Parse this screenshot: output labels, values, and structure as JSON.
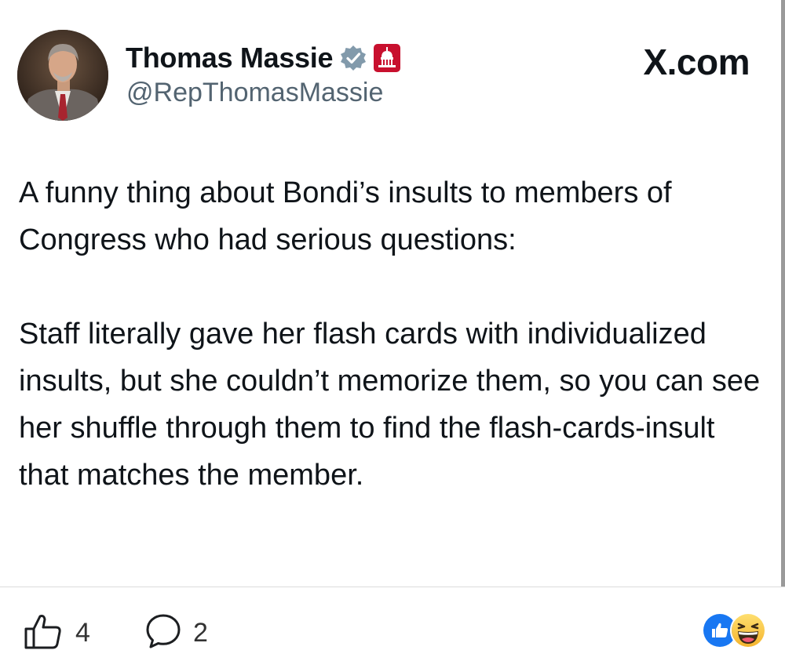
{
  "tweet": {
    "display_name": "Thomas Massie",
    "handle": "@RepThomasMassie",
    "site_label": "X.com",
    "paragraphs": [
      "A funny thing about Bondi’s insults to members of Congress who had serious questions:",
      "Staff literally gave her flash cards with individualized insults, but she couldn’t memorize them, so you can see her shuffle through them to find the flash-cards-insult that matches the member."
    ],
    "verified_badge_icon": "verified-badge-icon",
    "government_badge_icon": "us-capitol-icon"
  },
  "footer": {
    "like_count": "4",
    "comment_count": "2",
    "reactions": [
      "like-reaction-icon",
      "haha-reaction-icon"
    ]
  },
  "colors": {
    "text": "#0f1419",
    "handle": "#536471",
    "badge_gray": "#829aab",
    "gov_red": "#c8102e",
    "facebook_blue": "#1877f2",
    "haha_yellow": "#f7c23c"
  }
}
